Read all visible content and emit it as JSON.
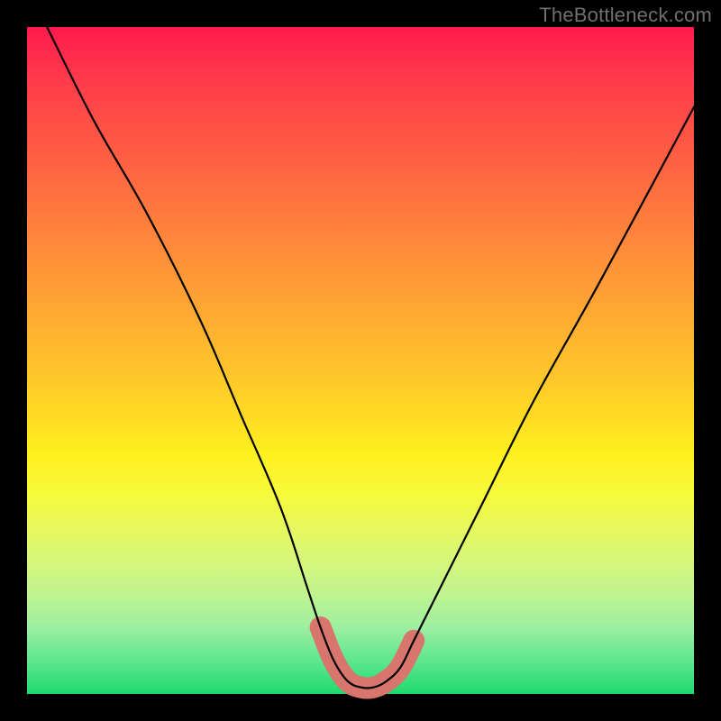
{
  "watermark": "TheBottleneck.com",
  "chart_data": {
    "type": "line",
    "title": "",
    "xlabel": "",
    "ylabel": "",
    "xlim": [
      0,
      100
    ],
    "ylim": [
      0,
      100
    ],
    "series": [
      {
        "name": "bottleneck-curve",
        "x": [
          3,
          10,
          18,
          26,
          32,
          38,
          42,
          44,
          46,
          48,
          50,
          52,
          54,
          56,
          58,
          62,
          68,
          76,
          86,
          100
        ],
        "y": [
          100,
          86,
          72,
          56,
          42,
          28,
          16,
          10,
          5,
          2,
          1,
          1,
          2,
          4,
          8,
          16,
          28,
          44,
          62,
          88
        ]
      },
      {
        "name": "bottleneck-band",
        "x": [
          44,
          46,
          48,
          50,
          52,
          54,
          56,
          58
        ],
        "y": [
          10,
          5,
          2,
          1,
          1,
          2,
          4,
          8
        ]
      }
    ],
    "colors": {
      "curve": "#000000",
      "band": "#d8756d",
      "gradient_top": "#ff1a4d",
      "gradient_bottom": "#1fd96e"
    }
  }
}
